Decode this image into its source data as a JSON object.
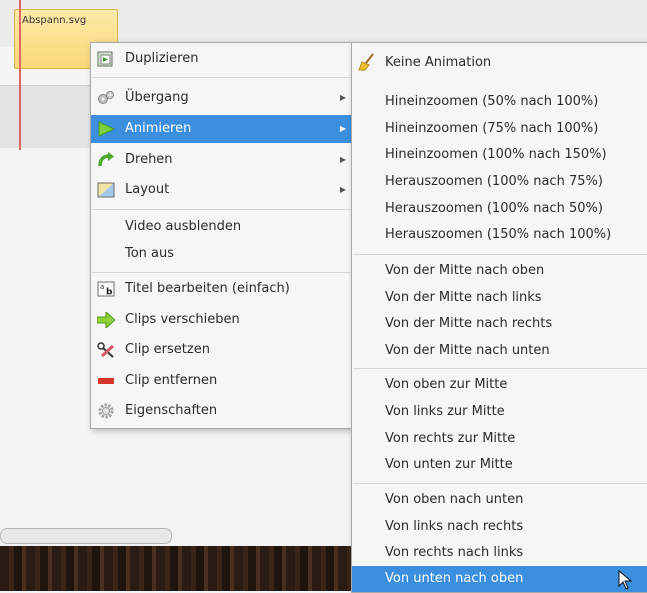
{
  "timeline": {
    "clip_name": "Abspann.svg"
  },
  "context_menu": {
    "items": [
      {
        "label": "Duplizieren",
        "icon": "duplicate-icon",
        "submenu": false
      },
      {
        "label": "Übergang",
        "icon": "transition-gears-icon",
        "submenu": true
      },
      {
        "label": "Animieren",
        "icon": "play-arrow-icon",
        "submenu": true,
        "highlighted": true
      },
      {
        "label": "Drehen",
        "icon": "rotate-arrow-icon",
        "submenu": true
      },
      {
        "label": "Layout",
        "icon": "layout-icon",
        "submenu": true
      },
      {
        "label": "Video ausblenden",
        "submenu": false
      },
      {
        "label": "Ton aus",
        "submenu": false
      },
      {
        "label": "Titel bearbeiten (einfach)",
        "icon": "text-edit-icon",
        "submenu": false
      },
      {
        "label": "Clips verschieben",
        "icon": "move-arrow-icon",
        "submenu": false
      },
      {
        "label": "Clip ersetzen",
        "icon": "scissors-icon",
        "submenu": false
      },
      {
        "label": "Clip entfernen",
        "icon": "remove-bar-icon",
        "submenu": false
      },
      {
        "label": "Eigenschaften",
        "icon": "settings-gear-icon",
        "submenu": false
      }
    ]
  },
  "animation_submenu": {
    "items": [
      {
        "label": "Keine Animation",
        "icon": "broom-icon"
      },
      {
        "label": "Hineinzoomen (50% nach 100%)"
      },
      {
        "label": "Hineinzoomen (75% nach 100%)"
      },
      {
        "label": "Hineinzoomen (100% nach 150%)"
      },
      {
        "label": "Herauszoomen (100% nach 75%)"
      },
      {
        "label": "Herauszoomen (100% nach 50%)"
      },
      {
        "label": "Herauszoomen (150% nach 100%)"
      },
      {
        "label": "Von der Mitte nach oben"
      },
      {
        "label": "Von der Mitte nach links"
      },
      {
        "label": "Von der Mitte nach rechts"
      },
      {
        "label": "Von der Mitte nach unten"
      },
      {
        "label": "Von oben zur Mitte"
      },
      {
        "label": "Von links zur Mitte"
      },
      {
        "label": "Von rechts zur Mitte"
      },
      {
        "label": "Von unten zur Mitte"
      },
      {
        "label": "Von oben nach unten"
      },
      {
        "label": "Von links nach rechts"
      },
      {
        "label": "Von rechts nach links"
      },
      {
        "label": "Von unten nach oben",
        "highlighted": true
      }
    ]
  },
  "colors": {
    "highlight": "#3b8fde",
    "clip": "#f8d978"
  }
}
